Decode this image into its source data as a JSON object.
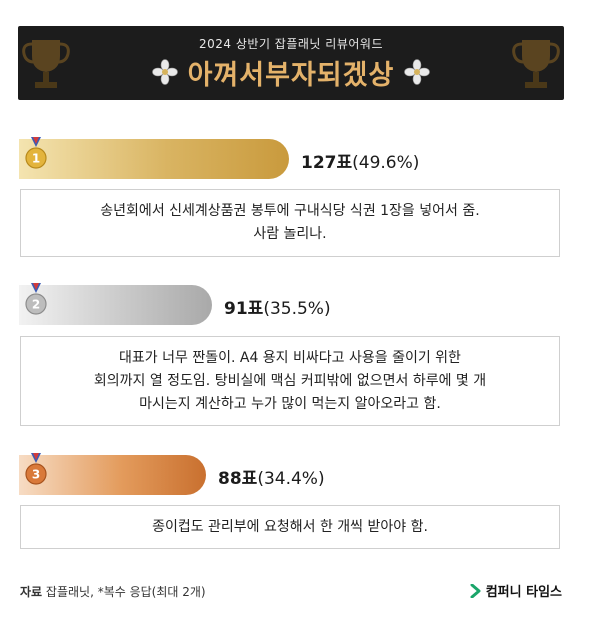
{
  "header": {
    "subtitle": "2024 상반기 잡플래닛 리뷰어워드",
    "title": "아껴서부자되겠상"
  },
  "chart_data": {
    "type": "bar",
    "categories": [
      "1",
      "2",
      "3"
    ],
    "values": [
      127,
      91,
      88
    ],
    "value_labels": [
      "127표",
      "91표",
      "88표"
    ],
    "percent_labels": [
      "(49.6%)",
      "(35.5%)",
      "(34.4%)"
    ],
    "percents": [
      49.6,
      35.5,
      34.4
    ],
    "rank_colors": [
      "#d9b462",
      "#b8b8b8",
      "#e08a45"
    ],
    "comments": [
      [
        "송년회에서 신세계상품권 봉투에 구내식당 식권 1장을 넣어서 줌.",
        "사람 놀리나."
      ],
      [
        "대표가 너무 짠돌이. A4 용지 비싸다고 사용을 줄이기 위한",
        "회의까지 열 정도임. 탕비실에 맥심 커피밖에 없으면서 하루에 몇 개",
        "마시는지 계산하고 누가 많이 먹는지 알아오라고 함."
      ],
      [
        "종이컵도 관리부에 요청해서 한 개씩 받아야 함."
      ]
    ]
  },
  "footer": {
    "source_label": "자료",
    "source_text": " 잡플래닛, *복수 응답(최대 2개)",
    "brand": "컴퍼니 타임스"
  }
}
